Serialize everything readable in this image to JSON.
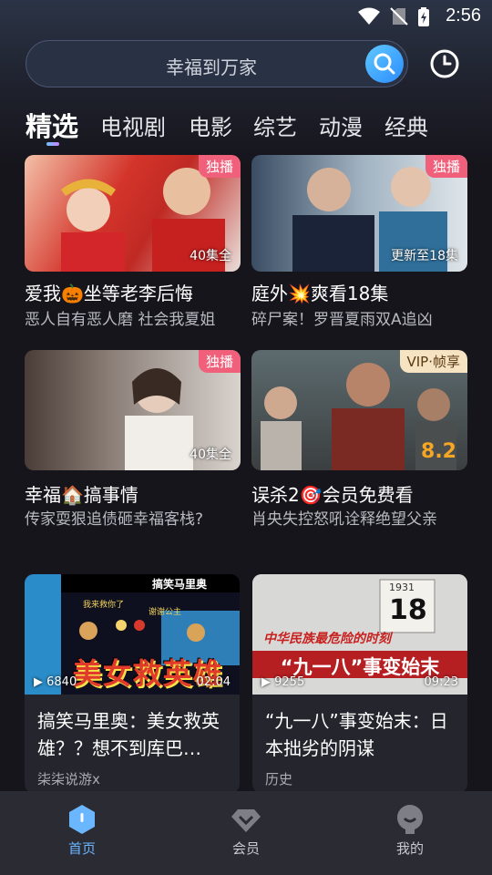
{
  "status": {
    "time": "2:56"
  },
  "search": {
    "placeholder": "幸福到万家"
  },
  "tabs": [
    "精选",
    "电视剧",
    "电影",
    "综艺",
    "动漫",
    "经典"
  ],
  "cards": [
    {
      "title": "爱我🎃坐等老李后悔",
      "subtitle": "恶人自有恶人磨 社会我夏姐",
      "badge": "独播",
      "episodes": "40集全"
    },
    {
      "title": "庭外💥爽看18集",
      "subtitle": "碎尸案！罗晋夏雨双A追凶",
      "badge": "独播",
      "episodes": "更新至18集"
    },
    {
      "title": "幸福🏠搞事情",
      "subtitle": "传家耍狠追债砸幸福客栈?",
      "badge": "独播",
      "episodes": "40集全"
    },
    {
      "title": "误杀2🎯会员免费看",
      "subtitle": "肖央失控怒吼诠释绝望父亲",
      "badge": "VIP·帧享",
      "score": "8.2"
    }
  ],
  "videos": [
    {
      "title": "搞笑马里奥：美女救英雄？？想不到库巴…",
      "author": "柒柒说游x",
      "plays": "6840",
      "duration": "02:04",
      "thumb_top": "搞笑马里奥",
      "thumb_caption": "美女救英雄",
      "thumb_bubble1": "我来救你了",
      "thumb_bubble2": "谢谢公主"
    },
    {
      "title": "“九一八”事变始末：日本拙劣的阴谋",
      "author": "历史",
      "plays": "9255",
      "duration": "09:23",
      "thumb_line": "中华民族最危险的时刻",
      "thumb_caption": "“九一八”事变始末",
      "thumb_cal_year": "1931",
      "thumb_cal_day": "18"
    }
  ],
  "nav": [
    {
      "label": "首页",
      "active": true
    },
    {
      "label": "会员",
      "active": false
    },
    {
      "label": "我的",
      "active": false
    }
  ]
}
